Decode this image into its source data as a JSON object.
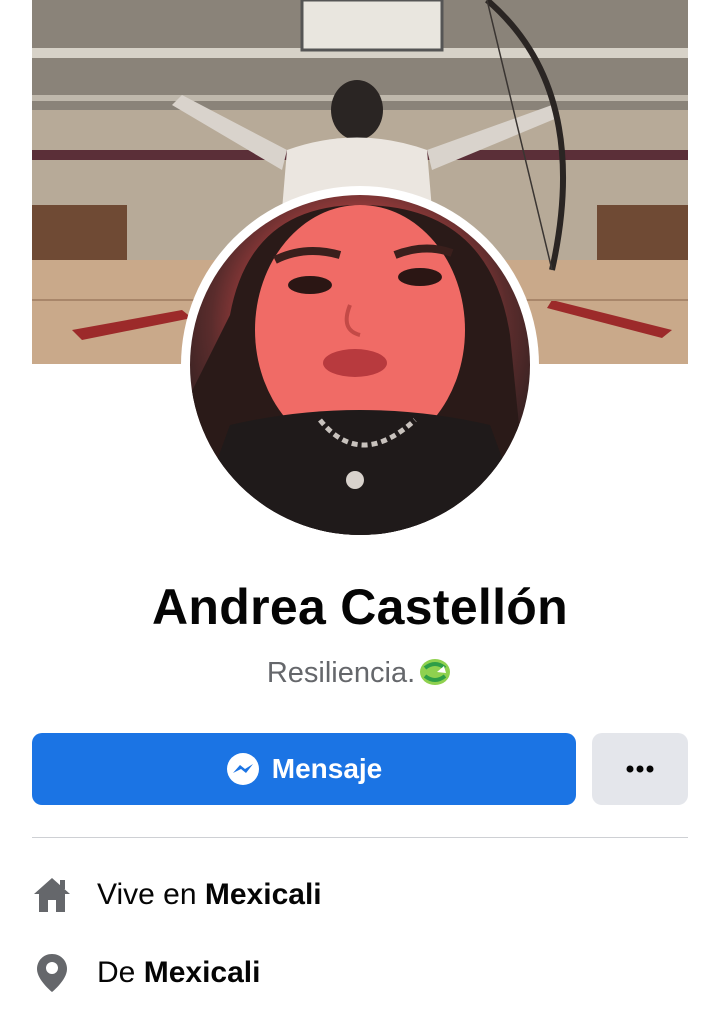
{
  "profile": {
    "name": "Andrea Castellón",
    "bio": "Resiliencia.",
    "bio_emoji": "recycle-hands-emoji"
  },
  "actions": {
    "message_label": "Mensaje",
    "more_label": "•••"
  },
  "details": [
    {
      "icon": "home-icon",
      "prefix": "Vive en",
      "value": "Mexicali"
    },
    {
      "icon": "location-pin-icon",
      "prefix": "De",
      "value": "Mexicali"
    }
  ],
  "colors": {
    "primary": "#1b74e4",
    "secondary_button": "#e4e6eb",
    "muted_text": "#65676b",
    "icon_gray": "#65676b"
  }
}
